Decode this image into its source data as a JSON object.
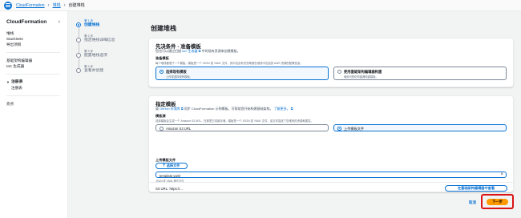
{
  "breadcrumb": {
    "root": "CloudFormation",
    "middle": "堆栈",
    "current": "创建堆栈"
  },
  "sidebar": {
    "title": "CloudFormation",
    "items_top": [
      "堆栈",
      "StackSets",
      "导出项目"
    ],
    "items_mid": [
      "基础架构编辑器",
      "IaC 生成器"
    ],
    "group": "注册表",
    "group_items": [
      "注册表"
    ],
    "items_bottom": [
      "亮点"
    ]
  },
  "steps": [
    {
      "num": "第 1 步",
      "name": "创建堆栈"
    },
    {
      "num": "第 2 步",
      "name": "指定堆栈详细信息"
    },
    {
      "num": "第 3 步",
      "name": "配置堆栈选项"
    },
    {
      "num": "第 4 步",
      "name": "查看并创建"
    }
  ],
  "page_title": "创建堆栈",
  "prereq": {
    "heading": "先决条件 - 准备模板",
    "sub_prefix": "您也可以通过扫描",
    "sub_link": "IaC 生成器",
    "sub_suffix": "中的现有资源来创建模板。",
    "field_label": "准备模板",
    "field_desc": "每个堆栈都基于一个模板。模板是一个 JSON 或 YAML 文件，其中包含有关您希望在堆栈中包括的 AWS 资源的配置信息。",
    "options": [
      {
        "title": "选择现有模板",
        "desc": "上传或选择现有模板。"
      },
      {
        "title": "使用基础架构编辑器构建",
        "desc": "使用可视化构建器构建模板。"
      }
    ]
  },
  "template": {
    "heading": "指定模板",
    "sub_prefix": "或",
    "sub_link1": "GitHub 存储库",
    "sub_mid": "同步 CloudFormation 示例模板。可帮助您开始构建基础架构。",
    "sub_link2": "了解更多。",
    "source_label": "模板源",
    "source_desc": "选择模板会生成一个 Amazon S3 URL，在那里它将被存储。模板是一个 JSON 或 YAML 文件，该文件描述了您堆栈的资源和属性。",
    "source_options": [
      "Amazon S3 URL",
      "上传模板文件"
    ],
    "upload_label": "上传模板文件",
    "upload_button": "选择文件",
    "file_name": "template.yaml",
    "file_meta": "JSON 或 YAML 格式文件",
    "s3_label": "S3 URL:",
    "s3_value": "https://...",
    "view_button": "在基础架构编辑器中查看"
  },
  "footer": {
    "cancel": "取消",
    "next": "下一步"
  },
  "colors": {
    "accent": "#0972d3",
    "primary_button": "#ff9900",
    "highlight": "#d91515"
  }
}
